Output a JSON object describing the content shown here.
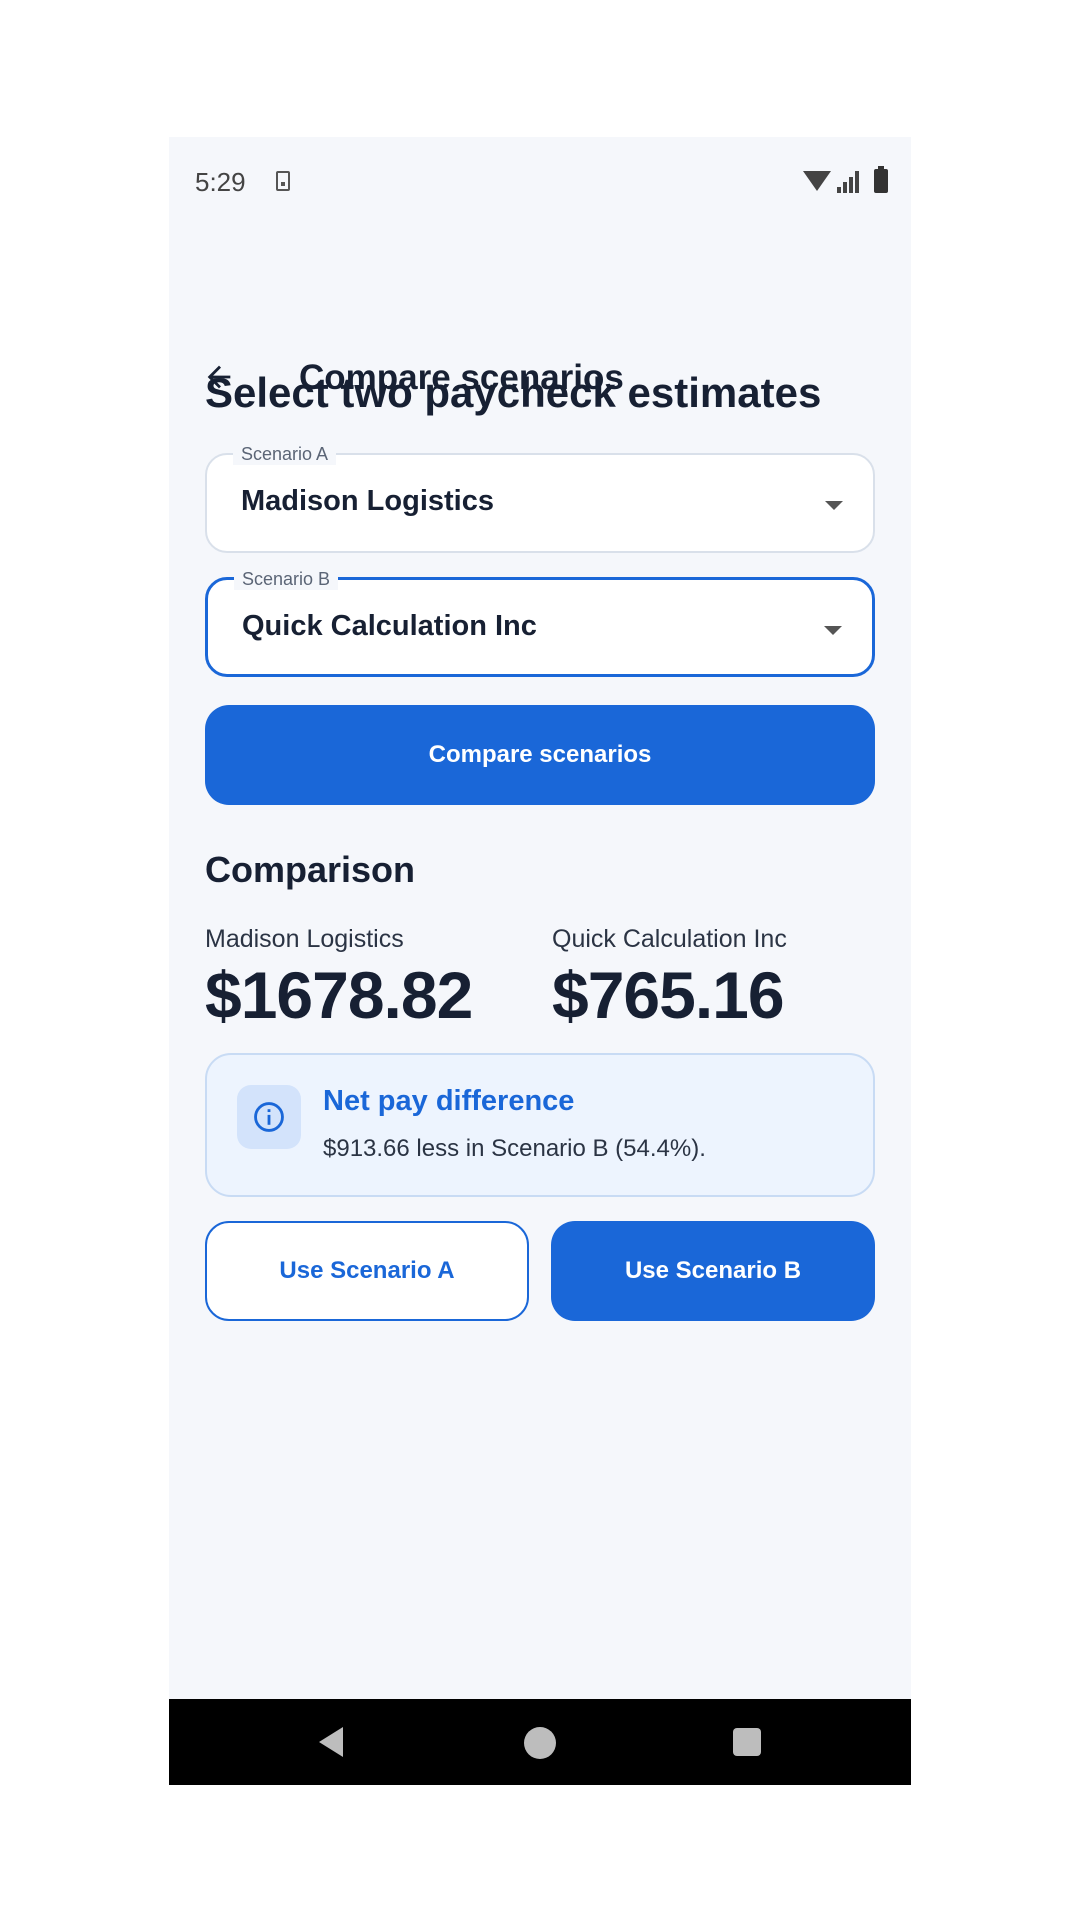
{
  "status_bar": {
    "time": "5:29"
  },
  "app_bar": {
    "title": "Compare scenarios"
  },
  "main": {
    "heading": "Select two paycheck estimates",
    "scenario_a": {
      "label": "Scenario A",
      "value": "Madison Logistics"
    },
    "scenario_b": {
      "label": "Scenario B",
      "value": "Quick Calculation Inc"
    },
    "compare_button": "Compare scenarios",
    "comparison": {
      "title": "Comparison",
      "a_name": "Madison Logistics",
      "a_amount": "$1678.82",
      "b_name": "Quick Calculation Inc",
      "b_amount": "$765.16"
    },
    "difference": {
      "title": "Net pay difference",
      "text": "$913.66 less in Scenario B (54.4%)."
    },
    "use_a_button": "Use Scenario A",
    "use_b_button": "Use Scenario B"
  },
  "colors": {
    "primary": "#1a67d8",
    "text": "#172033",
    "background": "#f5f7fb",
    "info_bg": "#edf4fe"
  },
  "icons": {
    "back": "arrow-left-icon",
    "info": "info-icon",
    "dropdown": "caret-down-icon"
  }
}
